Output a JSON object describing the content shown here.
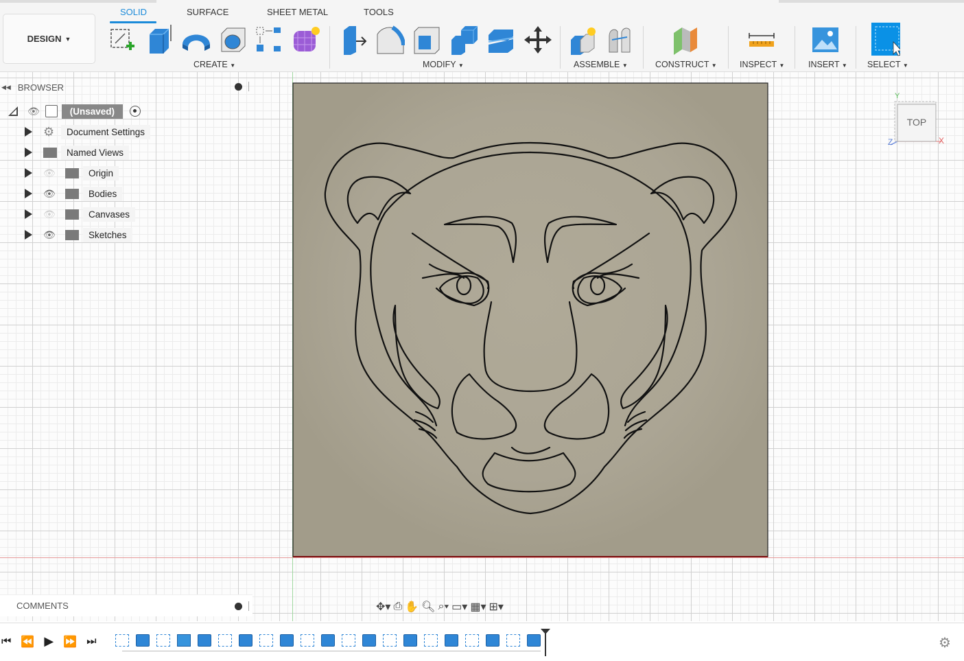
{
  "workspace": {
    "label": "DESIGN"
  },
  "tabs": [
    {
      "label": "SOLID",
      "active": true
    },
    {
      "label": "SURFACE",
      "active": false
    },
    {
      "label": "SHEET METAL",
      "active": false
    },
    {
      "label": "TOOLS",
      "active": false
    }
  ],
  "toolbar_groups": {
    "create": "CREATE",
    "modify": "MODIFY",
    "assemble": "ASSEMBLE",
    "construct": "CONSTRUCT",
    "inspect": "INSPECT",
    "insert": "INSERT",
    "select": "SELECT"
  },
  "tools": {
    "create": [
      "create-sketch-icon",
      "extrude-icon",
      "revolve-icon",
      "hole-icon",
      "pattern-icon",
      "create-form-icon"
    ],
    "modify": [
      "press-pull-icon",
      "fillet-icon",
      "shell-icon",
      "combine-icon",
      "split-icon",
      "move-icon"
    ],
    "assemble": [
      "new-component-icon",
      "joint-icon"
    ],
    "construct": [
      "offset-plane-icon"
    ],
    "inspect": [
      "measure-icon"
    ],
    "insert": [
      "insert-image-icon"
    ],
    "select": [
      "window-select-icon"
    ]
  },
  "browser": {
    "title": "BROWSER",
    "root": {
      "label": "(Unsaved)"
    },
    "items": [
      {
        "label": "Document Settings",
        "icon": "gear-icon",
        "visibility": "none"
      },
      {
        "label": "Named Views",
        "icon": "folder-icon",
        "visibility": "none"
      },
      {
        "label": "Origin",
        "icon": "folder-icon",
        "visibility": "hidden"
      },
      {
        "label": "Bodies",
        "icon": "folder-icon",
        "visibility": "visible"
      },
      {
        "label": "Canvases",
        "icon": "folder-icon",
        "visibility": "hidden"
      },
      {
        "label": "Sketches",
        "icon": "folder-icon",
        "visibility": "visible"
      }
    ]
  },
  "comments": {
    "title": "COMMENTS"
  },
  "viewcube": {
    "face": "TOP",
    "axes": {
      "y": "Y",
      "x": "X",
      "z": "Z"
    }
  },
  "colors": {
    "accent": "#1a8ad9",
    "model_surface": "#aba594",
    "toolbar_bg": "#f5f5f5"
  },
  "timeline": {
    "controls": [
      "go-to-start-icon",
      "step-back-icon",
      "play-icon",
      "step-forward-icon",
      "go-to-end-icon"
    ],
    "features": [
      "sketch",
      "extrude",
      "sketch",
      "canvas",
      "extrude",
      "sketch",
      "extrude",
      "sketch",
      "extrude",
      "sketch",
      "extrude",
      "sketch",
      "extrude",
      "sketch",
      "extrude",
      "sketch",
      "extrude",
      "sketch",
      "extrude",
      "sketch",
      "extrude"
    ]
  },
  "navbar": [
    "orbit-icon",
    "look-at-icon",
    "pan-icon",
    "zoom-icon",
    "fit-icon",
    "display-settings-icon",
    "grid-settings-icon",
    "viewports-icon"
  ]
}
